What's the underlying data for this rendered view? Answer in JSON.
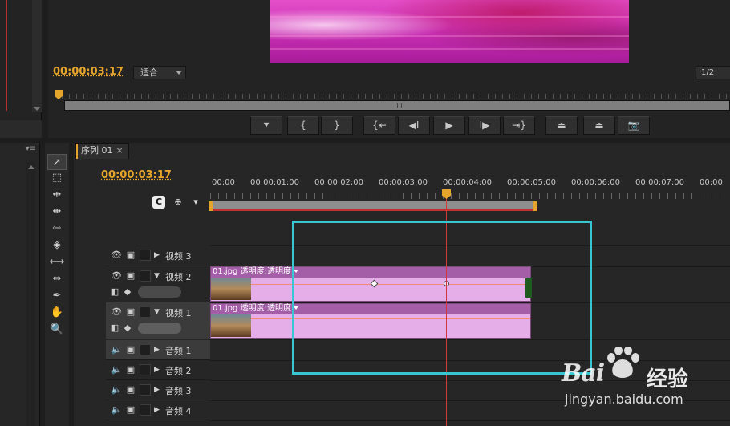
{
  "program_monitor": {
    "timecode": "00:00:03:17",
    "fit": "适合",
    "resolution": "1/2",
    "transport": [
      {
        "name": "add-marker-button",
        "glyph": "⯆"
      },
      {
        "name": "mark-in-button",
        "glyph": "{"
      },
      {
        "name": "mark-out-button",
        "glyph": "}"
      },
      {
        "name": "go-to-in-button",
        "glyph": "{⇤"
      },
      {
        "name": "step-back-button",
        "glyph": "◀I"
      },
      {
        "name": "play-button",
        "glyph": "▶"
      },
      {
        "name": "step-forward-button",
        "glyph": "I▶"
      },
      {
        "name": "go-to-out-button",
        "glyph": "⇥}"
      },
      {
        "name": "lift-button",
        "glyph": "⏏"
      },
      {
        "name": "extract-button",
        "glyph": "⏏"
      },
      {
        "name": "export-frame-button",
        "glyph": "📷"
      }
    ]
  },
  "timeline": {
    "tab_label": "序列 01",
    "tab_close": "×",
    "timecode": "00:00:03:17",
    "ruler": [
      "00:00",
      "00:00:01:00",
      "00:00:02:00",
      "00:00:03:00",
      "00:00:04:00",
      "00:00:05:00",
      "00:00:06:00",
      "00:00:07:00",
      "00:00"
    ],
    "tracks": {
      "v3": "视频 3",
      "v2": "视频 2",
      "v1": "视频 1",
      "a1": "音频 1",
      "a2": "音频 2",
      "a3": "音频 3",
      "a4": "音频 4"
    },
    "clips": {
      "v2": {
        "name": "01.jpg",
        "effect": "透明度:透明度"
      },
      "v1": {
        "name": "01.jpg",
        "effect": "透明度:透明度"
      }
    }
  },
  "watermark": {
    "brand": "Bai",
    "suffix": "经验",
    "url": "jingyan.baidu.com"
  },
  "colors": {
    "accent": "#e5a52c",
    "playhead": "#d03a3a",
    "clip": "#e6aee8",
    "clip_title": "#a45ea8",
    "highlight": "#38c7d2"
  }
}
